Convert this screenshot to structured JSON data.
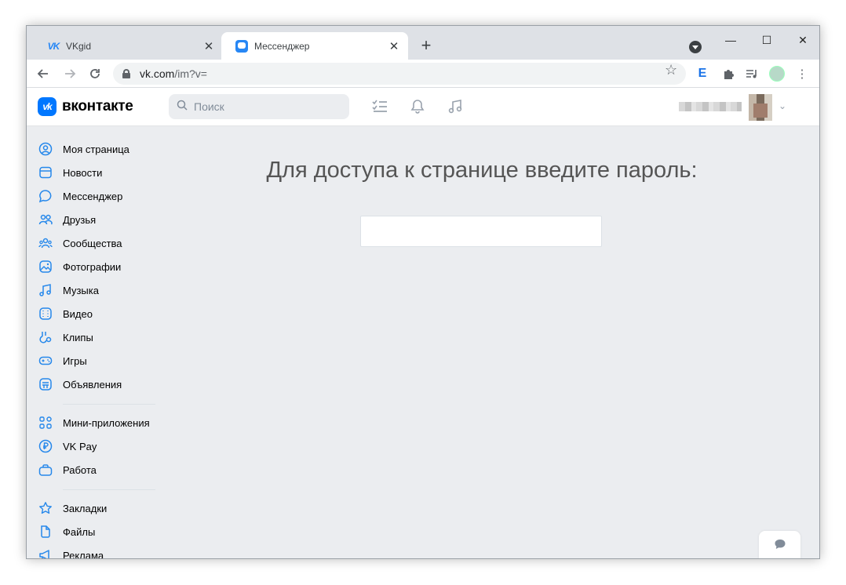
{
  "browser": {
    "tabs": [
      {
        "title": "VKgid",
        "active": false,
        "favicon": "vk-logo-icon"
      },
      {
        "title": "Мессенджер",
        "active": true,
        "favicon": "messenger-icon"
      }
    ],
    "new_tab_label": "+",
    "url_host": "vk.com",
    "url_path": "/im?v=",
    "extension_e_label": "E",
    "window_controls": {
      "minimize": "—",
      "maximize": "☐",
      "close": "✕"
    }
  },
  "vk_header": {
    "logo_badge": "vk",
    "logo_text": "вконтакте",
    "search_placeholder": "Поиск"
  },
  "sidebar": {
    "group1": [
      {
        "label": "Моя страница",
        "icon": "user-circle-icon"
      },
      {
        "label": "Новости",
        "icon": "news-icon"
      },
      {
        "label": "Мессенджер",
        "icon": "message-icon"
      },
      {
        "label": "Друзья",
        "icon": "friends-icon"
      },
      {
        "label": "Сообщества",
        "icon": "communities-icon"
      },
      {
        "label": "Фотографии",
        "icon": "photo-icon"
      },
      {
        "label": "Музыка",
        "icon": "music-icon"
      },
      {
        "label": "Видео",
        "icon": "video-icon"
      },
      {
        "label": "Клипы",
        "icon": "clips-icon"
      },
      {
        "label": "Игры",
        "icon": "gamepad-icon"
      },
      {
        "label": "Объявления",
        "icon": "ads-board-icon"
      }
    ],
    "group2": [
      {
        "label": "Мини-приложения",
        "icon": "apps-grid-icon"
      },
      {
        "label": "VK Pay",
        "icon": "vkpay-icon"
      },
      {
        "label": "Работа",
        "icon": "briefcase-icon"
      }
    ],
    "group3": [
      {
        "label": "Закладки",
        "icon": "star-icon"
      },
      {
        "label": "Файлы",
        "icon": "file-icon"
      },
      {
        "label": "Реклама",
        "icon": "megaphone-icon"
      }
    ]
  },
  "main": {
    "title": "Для доступа к странице введите пароль:",
    "password_value": ""
  },
  "colors": {
    "vk_blue": "#0077ff",
    "icon_blue": "#2688eb",
    "page_bg": "#ebedf0"
  }
}
